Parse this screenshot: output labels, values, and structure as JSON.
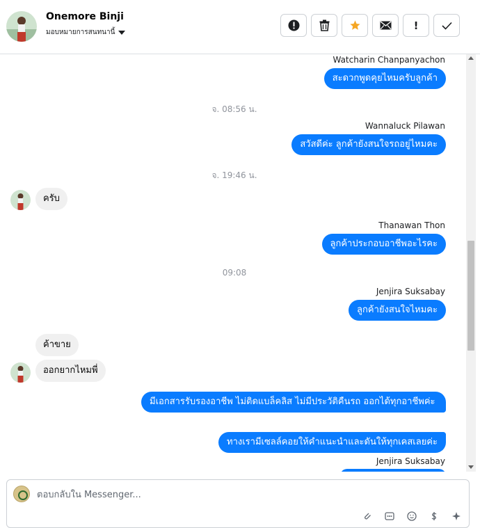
{
  "header": {
    "name": "Onemore Binji",
    "assign_label": "มอบหมายการสนทนานี้"
  },
  "toolbar": {
    "buttons": [
      {
        "name": "report-spam-button",
        "icon": "alert-circle-icon"
      },
      {
        "name": "delete-button",
        "icon": "trash-icon"
      },
      {
        "name": "star-button",
        "icon": "star-icon",
        "color": "#f5a623"
      },
      {
        "name": "mark-unread-button",
        "icon": "mail-icon"
      },
      {
        "name": "follow-up-button",
        "icon": "exclamation-icon",
        "label": "!"
      },
      {
        "name": "mark-done-button",
        "icon": "check-icon"
      }
    ]
  },
  "messages": {
    "m1_sender": "Watcharin Chanpanyachon",
    "m1_text": "สะดวกพูดคุยไหมครับลูกค้า",
    "t1": "จ. 08:56 น.",
    "m2_sender": "Wannaluck Pilawan",
    "m2_text": "สวัสดีค่ะ  ลูกค้ายังสนใจรถอยู่ไหมคะ",
    "t2": "จ. 19:46 น.",
    "m3_text": "ครับ",
    "m4_sender": "Thanawan Thon",
    "m4_text": "ลูกค้าประกอบอาชีพอะไรคะ",
    "t3": "09:08",
    "m5_sender": "Jenjira Suksabay",
    "m5_text": "ลูกค้ายังสนใจไหมคะ",
    "m6_text": "ค้าขาย",
    "m7_text": "ออกยากไหมพี่",
    "m8_text": "มีเอกสารรับรองอาชีพ ไม่ติดแบล็คลิส ไม่มีประวัติคืนรถ ออกได้ทุกอาชีพค่ะ",
    "m9_text": "ทางเรามีเซลล์คอยให้คำแนะนำและดันให้ทุกเคสเลยค่ะ",
    "m10_sender": "Jenjira Suksabay"
  },
  "composer": {
    "placeholder": "ตอบกลับใน Messenger..."
  },
  "colors": {
    "outgoing_bubble": "#0a7cff",
    "incoming_bubble": "#f0f0f0",
    "star": "#f5a623"
  }
}
